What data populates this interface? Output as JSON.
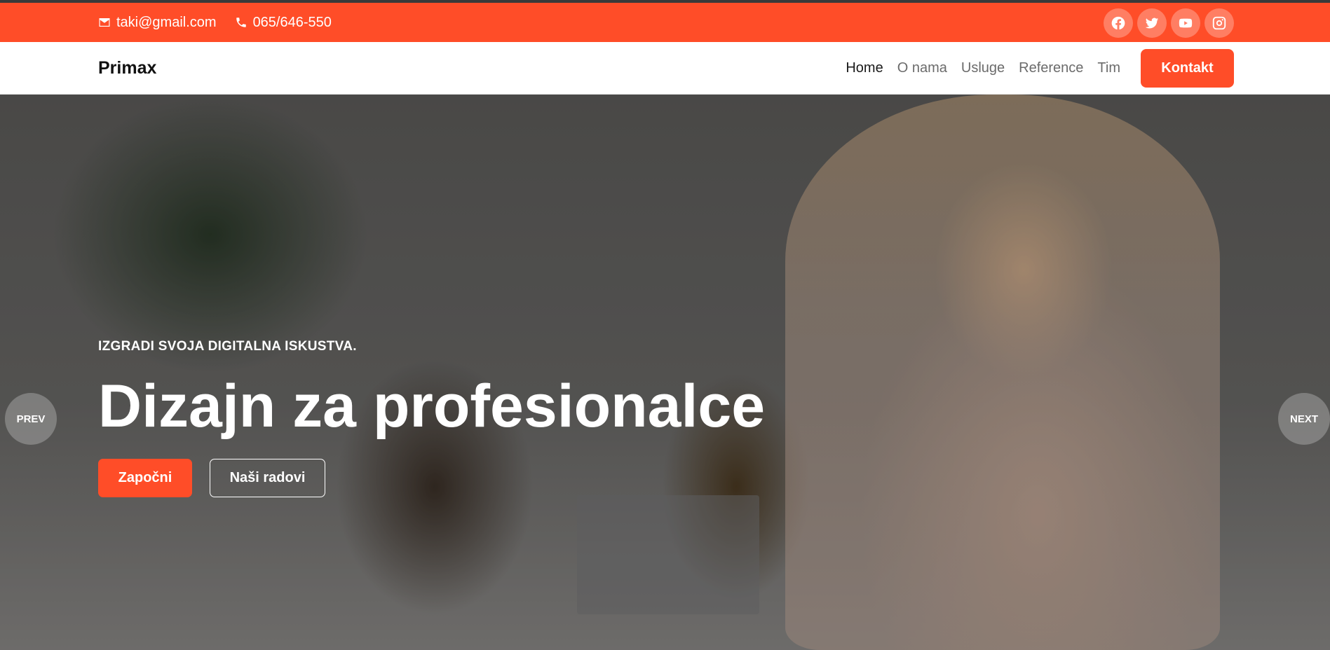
{
  "topbar": {
    "email": "taki@gmail.com",
    "phone": "065/646-550",
    "socials": [
      "facebook-icon",
      "twitter-icon",
      "youtube-icon",
      "instagram-icon"
    ]
  },
  "navbar": {
    "brand": "Primax",
    "links": [
      {
        "label": "Home",
        "active": true
      },
      {
        "label": "O nama",
        "active": false
      },
      {
        "label": "Usluge",
        "active": false
      },
      {
        "label": "Reference",
        "active": false
      },
      {
        "label": "Tim",
        "active": false
      }
    ],
    "cta": "Kontakt"
  },
  "hero": {
    "eyebrow": "IZGRADI SVOJA DIGITALNA ISKUSTVA.",
    "headline": "Dizajn za profesionalce",
    "primary_button": "Započni",
    "secondary_button": "Naši radovi",
    "prev": "PREV",
    "next": "NEXT"
  },
  "colors": {
    "accent": "#ff4d28",
    "top_strip": "#3a3a3a"
  }
}
